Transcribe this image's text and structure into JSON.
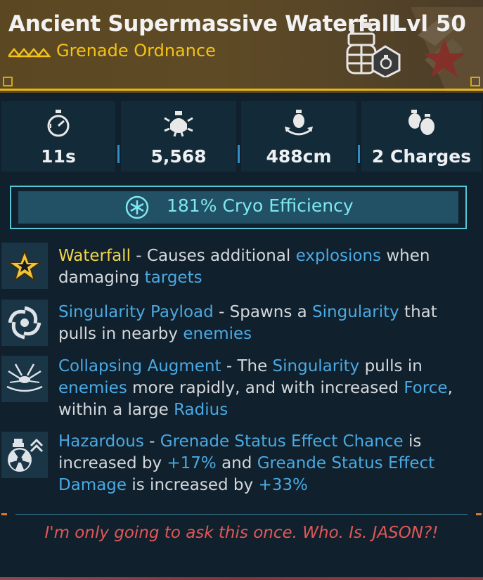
{
  "header": {
    "title": "Ancient Supermassive Waterfall",
    "level": "Lvl 50",
    "subtitle": "Grenade Ordnance",
    "rarity_icon": "rarity-chevrons-icon",
    "item_icon": "grenade-icon",
    "logo_icon": "manufacturer-star-logo",
    "accent_color": "#f3c318"
  },
  "stats": [
    {
      "icon": "stopwatch-icon",
      "value": "11s"
    },
    {
      "icon": "damage-burst-icon",
      "value": "5,568"
    },
    {
      "icon": "grenade-radius-icon",
      "value": "488cm"
    },
    {
      "icon": "grenade-charges-icon",
      "value": "2 Charges"
    }
  ],
  "element": {
    "icon": "cryo-snowflake-icon",
    "text": "181% Cryo Efficiency",
    "color": "#7de8f1"
  },
  "perks": [
    {
      "icon": "star-icon",
      "parts": [
        {
          "t": "Waterfall",
          "c": "yellow"
        },
        {
          "t": " - Causes additional ",
          "c": ""
        },
        {
          "t": "explosions",
          "c": "blue"
        },
        {
          "t": " when damaging ",
          "c": ""
        },
        {
          "t": "targets",
          "c": "blue"
        }
      ]
    },
    {
      "icon": "singularity-vortex-icon",
      "parts": [
        {
          "t": "Singularity Payload",
          "c": "blue"
        },
        {
          "t": " - Spawns a ",
          "c": ""
        },
        {
          "t": "Singularity",
          "c": "blue"
        },
        {
          "t": " that pulls in nearby ",
          "c": ""
        },
        {
          "t": "enemies",
          "c": "blue"
        }
      ]
    },
    {
      "icon": "collapsing-pull-icon",
      "parts": [
        {
          "t": "Collapsing Augment",
          "c": "blue"
        },
        {
          "t": " - The ",
          "c": ""
        },
        {
          "t": "Singularity",
          "c": "blue"
        },
        {
          "t": " pulls in ",
          "c": ""
        },
        {
          "t": "enemies",
          "c": "blue"
        },
        {
          "t": " more rapidly, and with increased ",
          "c": ""
        },
        {
          "t": "Force",
          "c": "blue"
        },
        {
          "t": ", within a large ",
          "c": ""
        },
        {
          "t": "Radius",
          "c": "blue"
        }
      ]
    },
    {
      "icon": "hazard-grenade-icon",
      "parts": [
        {
          "t": "Hazardous",
          "c": "blue"
        },
        {
          "t": " - ",
          "c": ""
        },
        {
          "t": "Grenade Status Effect Chance",
          "c": "blue"
        },
        {
          "t": " is increased by ",
          "c": ""
        },
        {
          "t": "+17%",
          "c": "blue"
        },
        {
          "t": " and ",
          "c": ""
        },
        {
          "t": "Greande Status Effect Damage",
          "c": "blue"
        },
        {
          "t": " is increased by ",
          "c": ""
        },
        {
          "t": "+33%",
          "c": "blue"
        }
      ]
    }
  ],
  "flavor_text": "I'm only going to ask this once. Who. Is. JASON?!",
  "colors": {
    "highlight_yellow": "#f0d54a",
    "highlight_blue": "#4aa9e3",
    "flavor_red": "#e25757"
  }
}
